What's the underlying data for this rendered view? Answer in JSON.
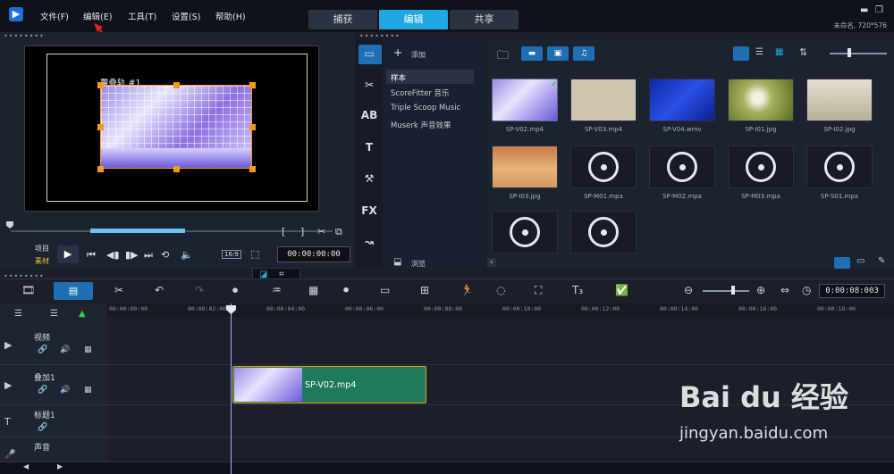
{
  "menubar": {
    "items": [
      "文件(F)",
      "编辑(E)",
      "工具(T)",
      "设置(S)",
      "帮助(H)"
    ],
    "tabs": [
      {
        "label": "捕获"
      },
      {
        "label": "编辑"
      },
      {
        "label": "共享"
      }
    ],
    "project": "未命名, 720*576"
  },
  "preview": {
    "overlay_label": "覆叠轨 #1",
    "project_label": "项目",
    "clip_label": "素材",
    "aspect": "16:9",
    "timecode": "00:00:00:00"
  },
  "library": {
    "add_label": "添加",
    "items": [
      "样本",
      "ScoreFitter 音乐",
      "Triple Scoop Music",
      "Muserk 声音效果"
    ],
    "browse_label": "浏览",
    "media": [
      {
        "name": "SP-V02.mp4",
        "kind": "video"
      },
      {
        "name": "SP-V03.mp4",
        "kind": "video"
      },
      {
        "name": "SP-V04.wmv",
        "kind": "video"
      },
      {
        "name": "SP-I01.jpg",
        "kind": "image"
      },
      {
        "name": "SP-I02.jpg",
        "kind": "image"
      },
      {
        "name": "SP-I03.jpg",
        "kind": "image"
      },
      {
        "name": "SP-M01.mpa",
        "kind": "audio"
      },
      {
        "name": "SP-M02.mpa",
        "kind": "audio"
      },
      {
        "name": "SP-M03.mpa",
        "kind": "audio"
      },
      {
        "name": "SP-S01.mpa",
        "kind": "audio"
      },
      {
        "name": "",
        "kind": "audio"
      },
      {
        "name": "",
        "kind": "audio"
      }
    ]
  },
  "timeline": {
    "timecode": "0:00:08:003",
    "ruler": [
      "00:00:00:00",
      "00:00:02:00",
      "00:00:04:00",
      "00:00:06:00",
      "00:00:08:00",
      "00:00:10:00",
      "00:00:12:00",
      "00:00:14:00",
      "00:00:16:00",
      "00:00:18:00"
    ],
    "tracks": [
      {
        "name": "视频"
      },
      {
        "name": "叠加1"
      },
      {
        "name": "标题1"
      },
      {
        "name": "声音"
      }
    ],
    "clip_name": "SP-V02.mp4"
  },
  "watermark": {
    "brand": "Bai du 经验",
    "url": "jingyan.baidu.com"
  },
  "colors": {
    "accent": "#1ea7e0",
    "handle": "#f29c1f",
    "clip": "#1f7a5a"
  }
}
